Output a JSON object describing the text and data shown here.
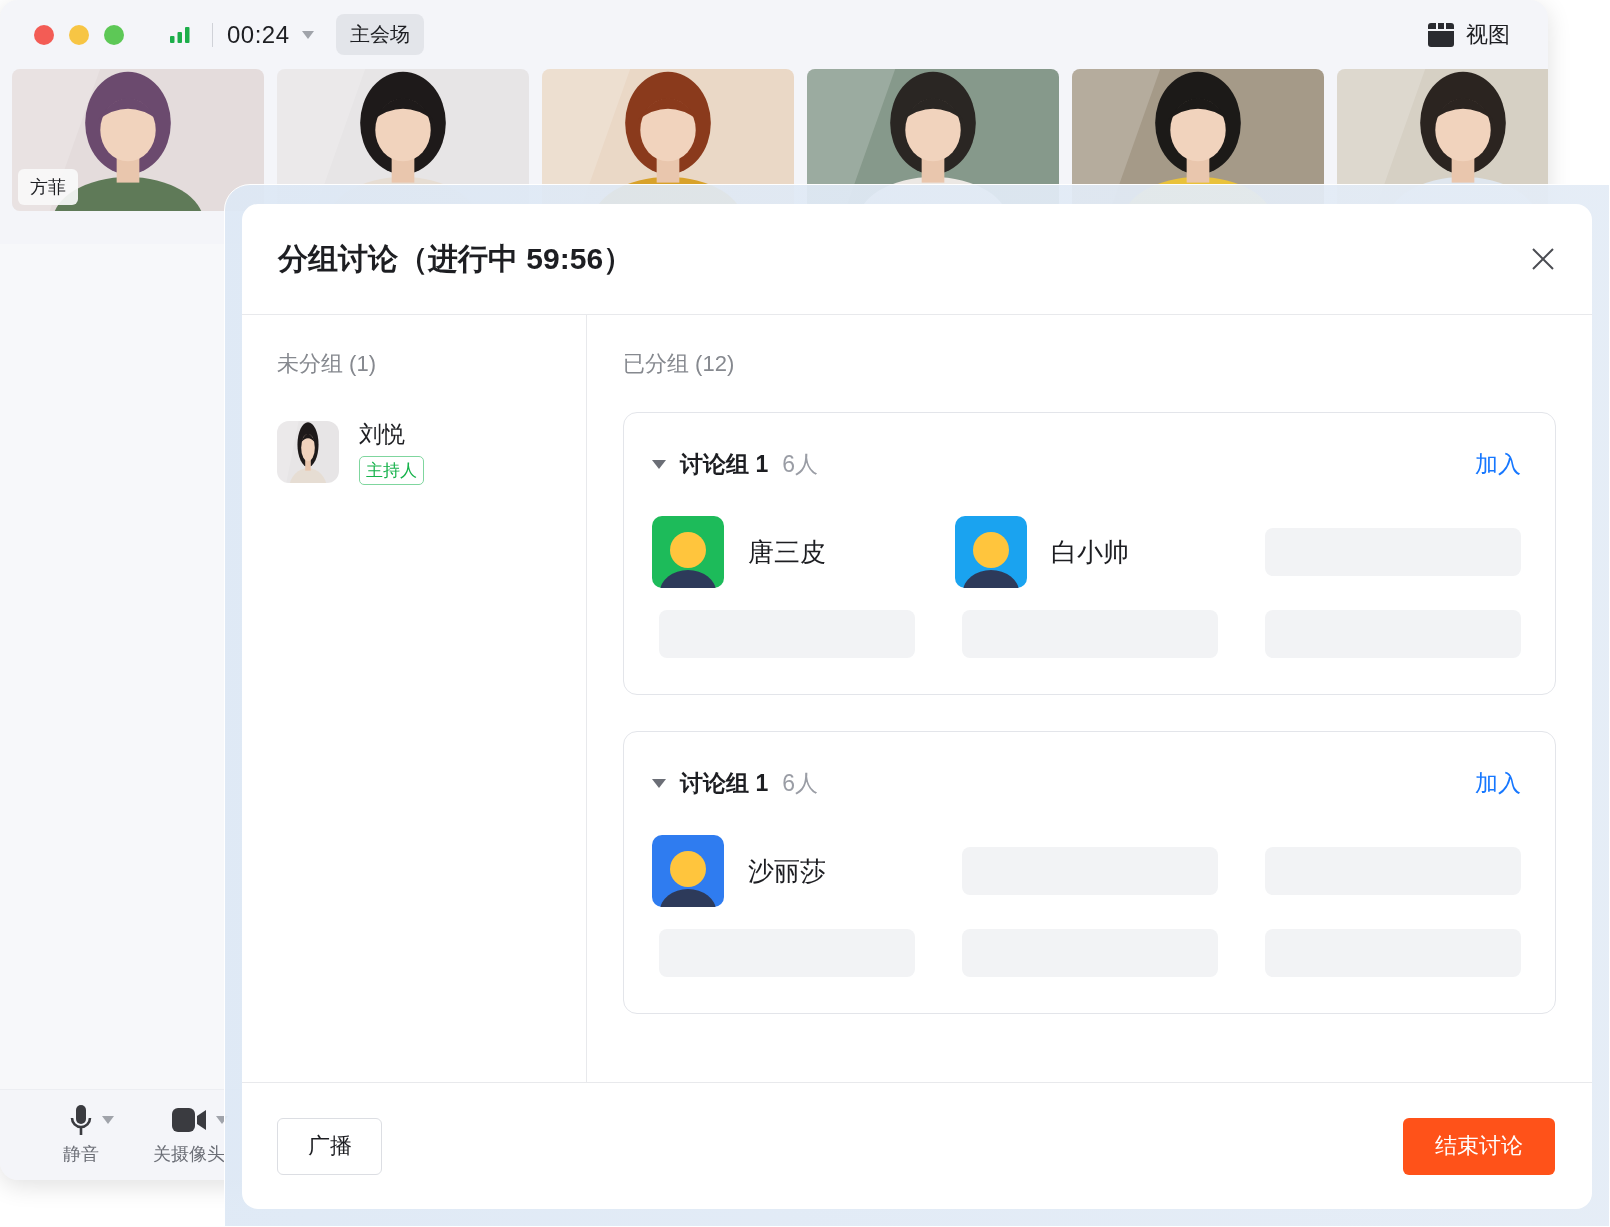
{
  "window": {
    "controls": [
      {
        "kind": "close"
      },
      {
        "kind": "minimize"
      },
      {
        "kind": "maximize"
      }
    ]
  },
  "top_bar": {
    "timer": "00:24",
    "venue_button": "主会场",
    "view_button": "视图"
  },
  "video_tiles": [
    {
      "kind": "picture",
      "name": "方菲"
    },
    {
      "kind": "picture"
    },
    {
      "kind": "picture"
    },
    {
      "kind": "picture"
    },
    {
      "kind": "picture"
    },
    {
      "kind": "picture"
    }
  ],
  "toolbar": [
    {
      "kind": "mic",
      "label": "静音"
    },
    {
      "kind": "camera",
      "label": "关摄像头"
    }
  ],
  "dialog": {
    "title": "分组讨论（进行中 59:56）",
    "unassigned": {
      "heading": "未分组 (1)",
      "members": [
        {
          "name": "刘悦",
          "tag": "主持人",
          "avatar": {
            "kind": "picture"
          }
        }
      ]
    },
    "assigned": {
      "heading": "已分组 (12)",
      "groups": [
        {
          "name": "讨论组 1",
          "count": "6人",
          "expanded": true,
          "join": "加入",
          "members": [
            {
              "kind": "person",
              "name": "唐三皮",
              "color": "#1dbb5a"
            },
            {
              "kind": "person",
              "name": "白小帅",
              "color": "#1aa3f0"
            },
            {
              "kind": "placeholder"
            },
            {
              "kind": "placeholder"
            },
            {
              "kind": "placeholder"
            },
            {
              "kind": "placeholder"
            }
          ]
        },
        {
          "name": "讨论组 1",
          "count": "6人",
          "expanded": true,
          "join": "加入",
          "members": [
            {
              "kind": "person",
              "name": "沙丽莎",
              "color": "#2f7cf0"
            },
            {
              "kind": "placeholder"
            },
            {
              "kind": "placeholder"
            },
            {
              "kind": "placeholder"
            },
            {
              "kind": "placeholder"
            },
            {
              "kind": "placeholder"
            }
          ]
        }
      ]
    },
    "footer": {
      "broadcast_button": "广播",
      "end_button": "结束讨论"
    }
  }
}
